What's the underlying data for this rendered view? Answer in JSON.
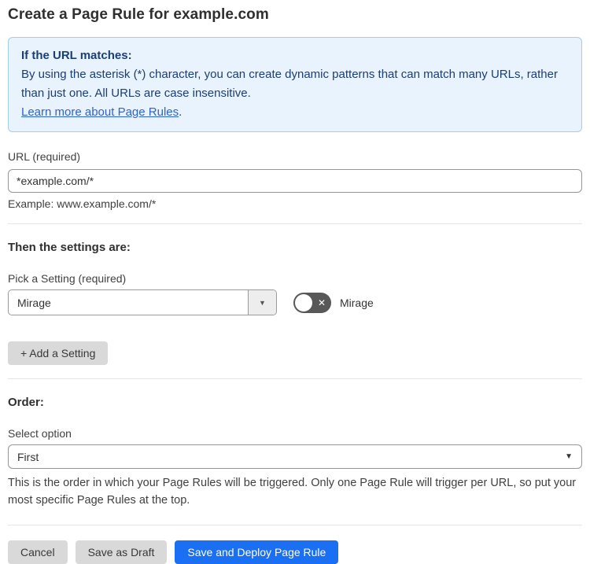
{
  "page": {
    "title": "Create a Page Rule for example.com"
  },
  "info_box": {
    "heading": "If the URL matches:",
    "body": "By using the asterisk (*) character, you can create dynamic patterns that can match many URLs, rather than just one. All URLs are case insensitive.",
    "link_label": "Learn more about Page Rules",
    "link_suffix": "."
  },
  "url_field": {
    "label": "URL (required)",
    "value": "*example.com/*",
    "helper": "Example: www.example.com/*"
  },
  "settings_section": {
    "heading": "Then the settings are:",
    "picker_label": "Pick a Setting (required)",
    "picker_value": "Mirage",
    "toggle_label": "Mirage",
    "toggle_state": "off",
    "add_setting_label": "+ Add a Setting"
  },
  "order_section": {
    "heading": "Order:",
    "select_label": "Select option",
    "select_value": "First",
    "helper": "This is the order in which your Page Rules will be triggered. Only one Page Rule will trigger per URL, so put your most specific Page Rules at the top."
  },
  "actions": {
    "cancel": "Cancel",
    "save_draft": "Save as Draft",
    "save_deploy": "Save and Deploy Page Rule"
  },
  "icons": {
    "chevron_glyph": "▼",
    "toggle_off_glyph": "✕"
  },
  "colors": {
    "info_bg": "#e9f3fd",
    "info_border": "#a5cdf0",
    "info_text": "#1b3e75",
    "link_blue": "#2f62d5",
    "primary_button_blue": "#1a6ff2",
    "gray_button": "#d9d9d9",
    "toggle_off_gray": "#585858"
  }
}
